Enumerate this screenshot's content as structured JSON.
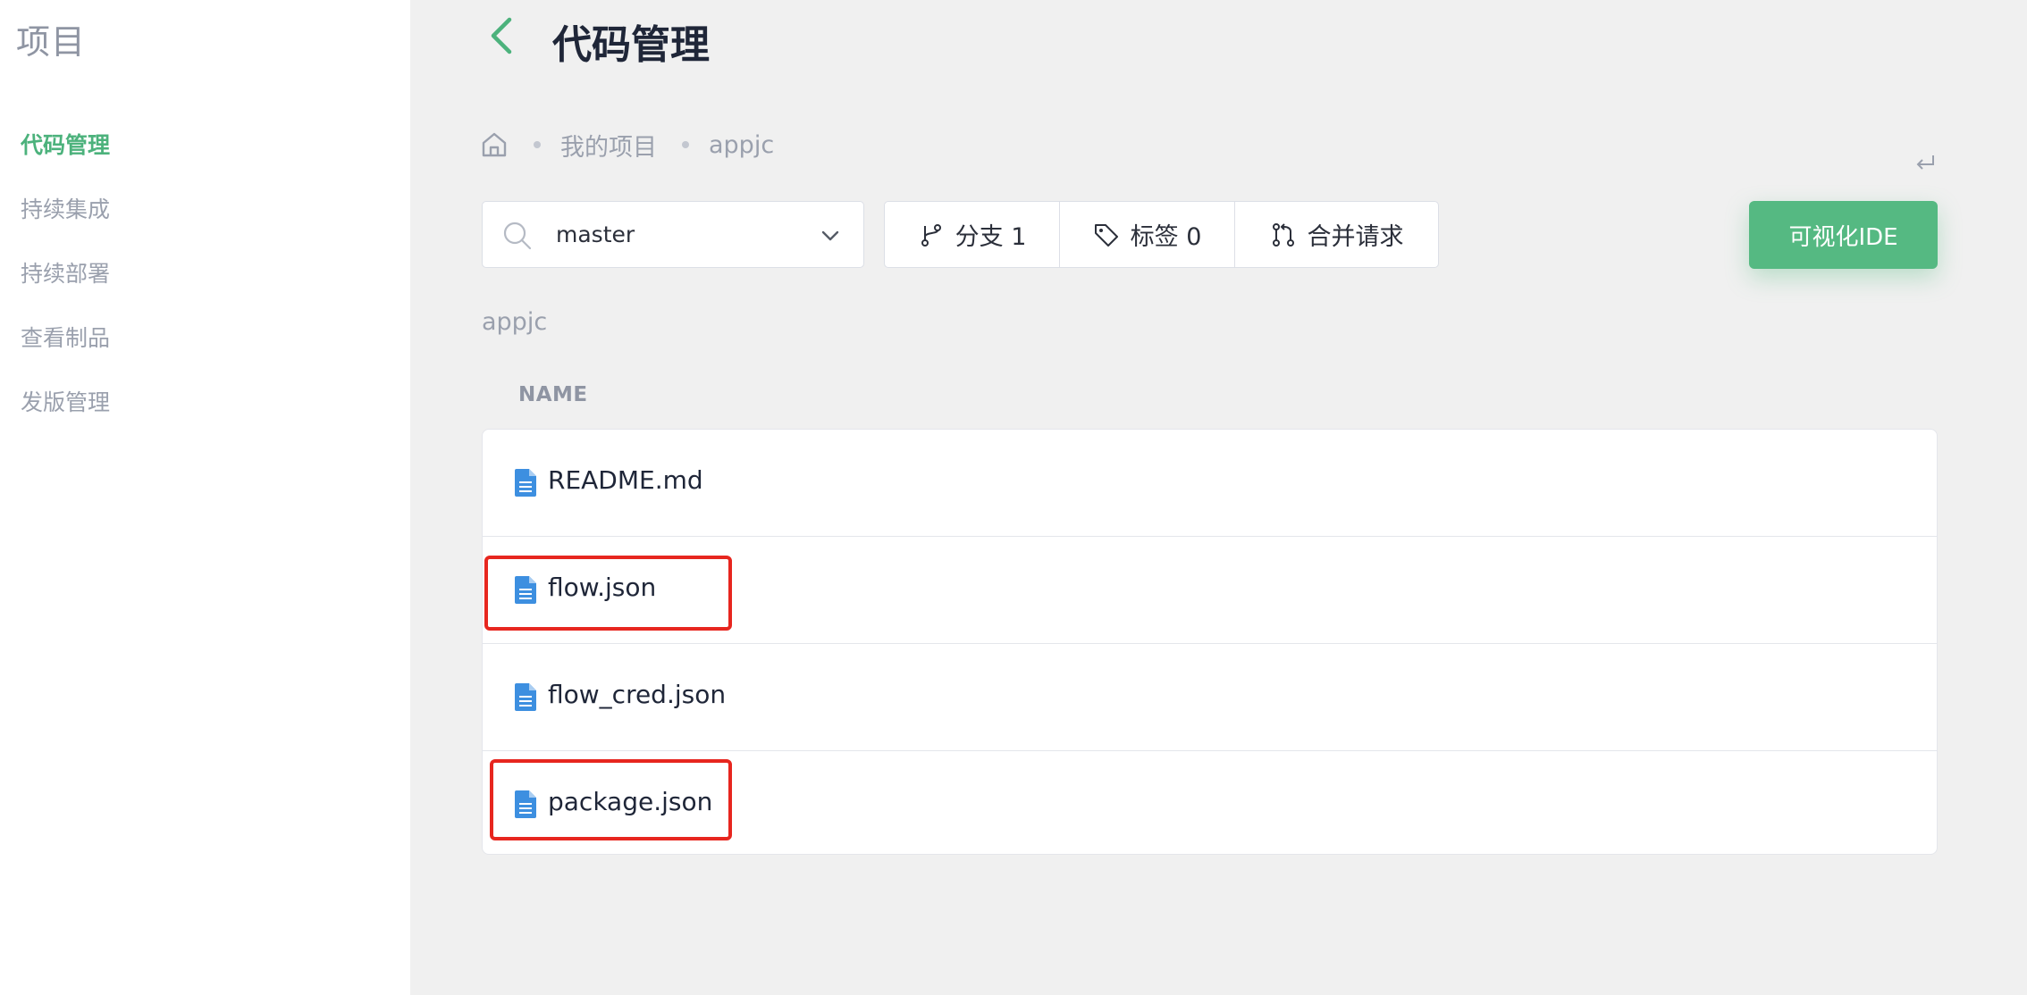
{
  "sidebar": {
    "title": "项目",
    "items": [
      {
        "label": "代码管理",
        "active": true
      },
      {
        "label": "持续集成",
        "active": false
      },
      {
        "label": "持续部署",
        "active": false
      },
      {
        "label": "查看制品",
        "active": false
      },
      {
        "label": "发版管理",
        "active": false
      }
    ]
  },
  "header": {
    "title": "代码管理"
  },
  "breadcrumb": {
    "items": [
      "我的项目",
      "appjc"
    ]
  },
  "branch_selector": {
    "value": "master"
  },
  "segments": {
    "branches": "分支 1",
    "tags": "标签 0",
    "merge_requests": "合并请求"
  },
  "ide_button": {
    "label": "可视化IDE"
  },
  "folder": {
    "name": "appjc"
  },
  "table": {
    "column_header": "NAME",
    "files": [
      "README.md",
      "flow.json",
      "flow_cred.json",
      "package.json"
    ]
  },
  "colors": {
    "accent": "#4cb27c",
    "button": "#55b982",
    "highlight": "#e7261f",
    "file_icon": "#3d8fe0"
  }
}
